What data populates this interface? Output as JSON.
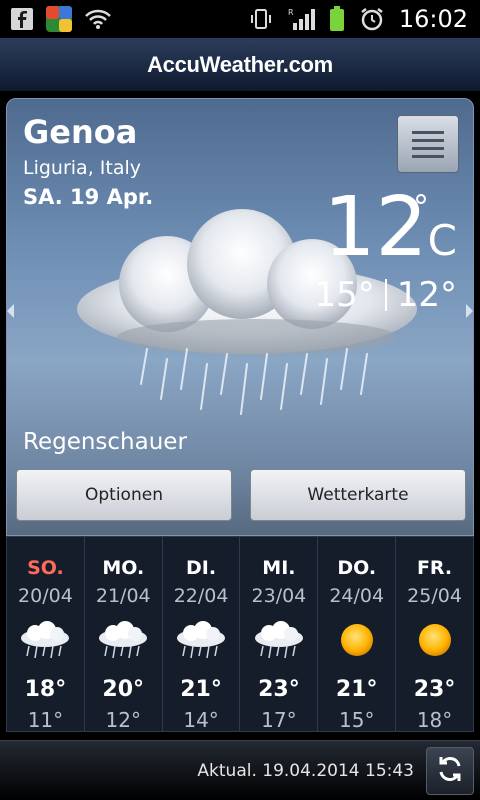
{
  "status_bar": {
    "time": "16:02",
    "roaming_label": "R"
  },
  "app": {
    "brand": "AccuWeather.com"
  },
  "current": {
    "city": "Genoa",
    "region": "Liguria, Italy",
    "date": "SA. 19 Apr.",
    "temp": "12",
    "unit": "C",
    "deg_symbol": "°",
    "high": "15°",
    "low": "12°",
    "condition": "Regenschauer"
  },
  "buttons": {
    "options": "Optionen",
    "map": "Wetterkarte"
  },
  "forecast": [
    {
      "day": "SO.",
      "date": "20/04",
      "high": "18°",
      "low": "11°",
      "icon": "rain-cloud-icon"
    },
    {
      "day": "MO.",
      "date": "21/04",
      "high": "20°",
      "low": "12°",
      "icon": "rain-cloud-icon"
    },
    {
      "day": "DI.",
      "date": "22/04",
      "high": "21°",
      "low": "14°",
      "icon": "rain-cloud-icon"
    },
    {
      "day": "MI.",
      "date": "23/04",
      "high": "23°",
      "low": "17°",
      "icon": "rain-cloud-icon"
    },
    {
      "day": "DO.",
      "date": "24/04",
      "high": "21°",
      "low": "15°",
      "icon": "sun-icon"
    },
    {
      "day": "FR.",
      "date": "25/04",
      "high": "23°",
      "low": "18°",
      "icon": "sun-icon"
    }
  ],
  "footer": {
    "updated": "Aktual. 19.04.2014 15:43"
  },
  "colors": {
    "sunday": "#ff6b5a",
    "accent_bg": "#151d2b"
  }
}
